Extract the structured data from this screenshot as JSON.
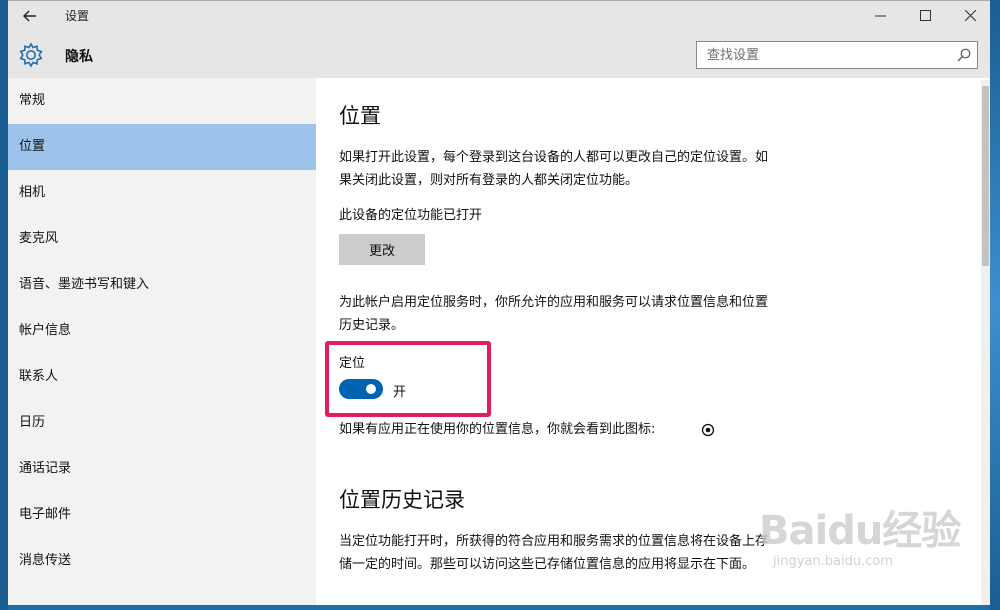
{
  "titlebar": {
    "title": "设置"
  },
  "header": {
    "section": "隐私",
    "search_placeholder": "查找设置"
  },
  "sidebar": {
    "items": [
      {
        "label": "常规",
        "active": false
      },
      {
        "label": "位置",
        "active": true
      },
      {
        "label": "相机",
        "active": false
      },
      {
        "label": "麦克风",
        "active": false
      },
      {
        "label": "语音、墨迹书写和键入",
        "active": false
      },
      {
        "label": "帐户信息",
        "active": false
      },
      {
        "label": "联系人",
        "active": false
      },
      {
        "label": "日历",
        "active": false
      },
      {
        "label": "通话记录",
        "active": false
      },
      {
        "label": "电子邮件",
        "active": false
      },
      {
        "label": "消息传送",
        "active": false
      }
    ]
  },
  "main": {
    "title": "位置",
    "intro": "如果打开此设置，每个登录到这台设备的人都可以更改自己的定位设置。如果关闭此设置，则对所有登录的人都关闭定位功能。",
    "device_status": "此设备的定位功能已打开",
    "change_button": "更改",
    "account_desc": "为此帐户启用定位服务时，你所允许的应用和服务可以请求位置信息和位置历史记录。",
    "toggle_label": "定位",
    "toggle_state": "开",
    "toggle_on": true,
    "icon_note": "如果有应用正在使用你的位置信息，你就会看到此图标:",
    "history_title": "位置历史记录",
    "history_desc": "当定位功能打开时，所获得的符合应用和服务需求的位置信息将在设备上存储一定的时间。那些可以访问这些已存储位置信息的应用将显示在下面。"
  },
  "watermark": {
    "logo": "Baidu经验",
    "url": "jingyan.baidu.com"
  },
  "colors": {
    "accent": "#0063b1",
    "highlight": "#e21c5e",
    "nav_active": "#9ec3ea"
  }
}
